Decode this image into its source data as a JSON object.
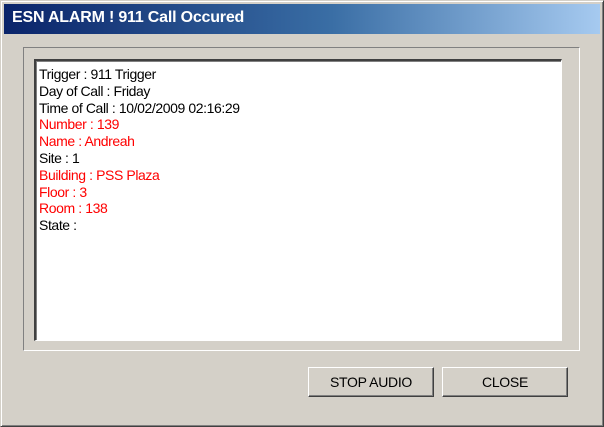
{
  "window": {
    "title": "ESN ALARM ! 911 Call Occured"
  },
  "details": {
    "lines": [
      {
        "text": "Trigger : 911 Trigger",
        "color": "#000000"
      },
      {
        "text": "Day of Call : Friday",
        "color": "#000000"
      },
      {
        "text": "Time of Call : 10/02/2009 02:16:29",
        "color": "#000000"
      },
      {
        "text": "Number : 139",
        "color": "#ff0000"
      },
      {
        "text": "Name : Andreah",
        "color": "#ff0000"
      },
      {
        "text": "Site : 1",
        "color": "#000000"
      },
      {
        "text": "Building : PSS Plaza",
        "color": "#ff0000"
      },
      {
        "text": "Floor : 3",
        "color": "#ff0000"
      },
      {
        "text": "Room : 138",
        "color": "#ff0000"
      },
      {
        "text": "State :",
        "color": "#000000"
      }
    ]
  },
  "buttons": {
    "stop_audio": "STOP AUDIO",
    "close": "CLOSE"
  }
}
